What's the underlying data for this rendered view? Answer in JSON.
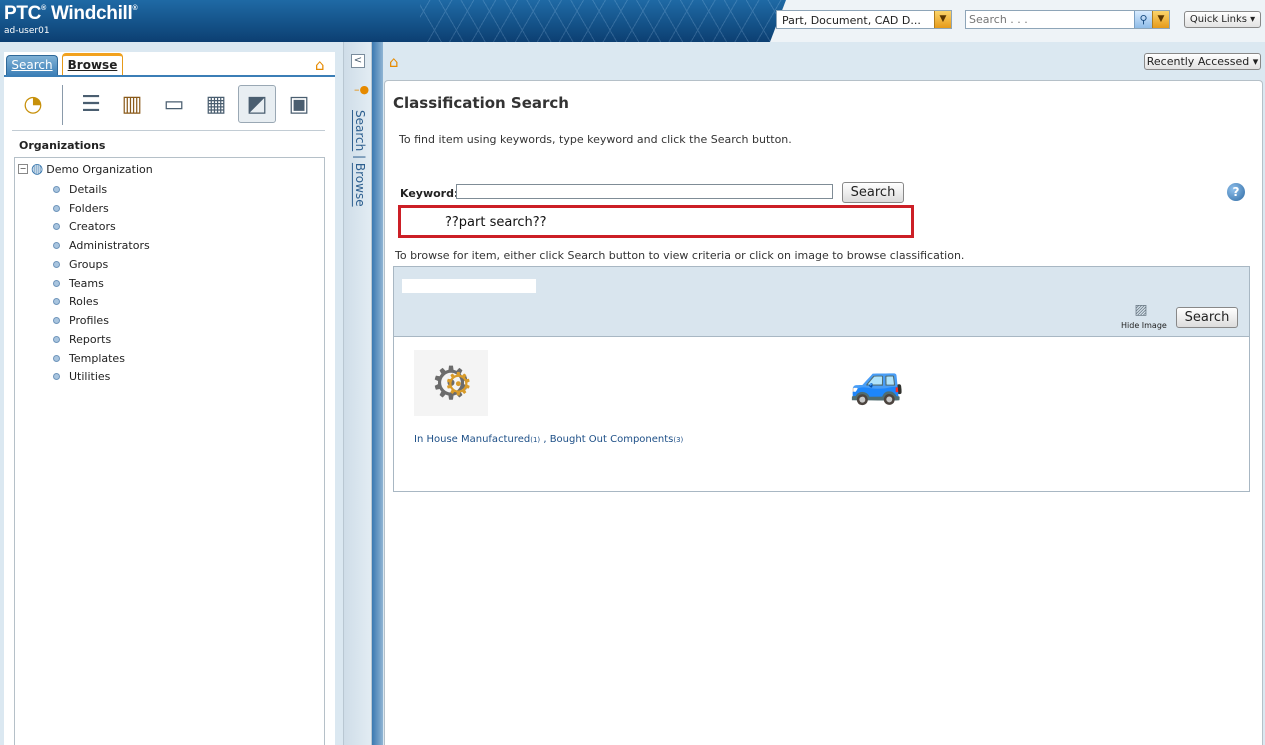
{
  "header": {
    "brand": "PTC",
    "brand_reg": "®",
    "brand_product": " Windchill",
    "brand_tm": "®",
    "user": "ad-user01",
    "type_select": "Part, Document, CAD D...",
    "search_placeholder": "Search . . .",
    "quick_links": "Quick Links ▾"
  },
  "left": {
    "tabs": [
      "Search",
      "Browse"
    ],
    "section_title": "Organizations",
    "org_root": "Demo Organization",
    "items": [
      "Details",
      "Folders",
      "Creators",
      "Administrators",
      "Groups",
      "Teams",
      "Roles",
      "Profiles",
      "Reports",
      "Templates",
      "Utilities"
    ]
  },
  "splitter": {
    "search_label": "Search",
    "divider": " | ",
    "browse_label": "Browse"
  },
  "main": {
    "recently_accessed": "Recently Accessed ▾",
    "title": "Classification Search",
    "instruction_keyword": "To find item using keywords, type keyword and click the Search button.",
    "keyword_label": "Keyword:",
    "keyword_value": "",
    "search_button": "Search",
    "annotation": "??part search??",
    "instruction_browse": "To browse for item, either click Search button to view criteria or click on image to browse classification.",
    "hide_image": "Hide Image",
    "result_link_1": "In House Manufactured",
    "result_count_1": "(1)",
    "result_sep": " , ",
    "result_link_2": "Bought Out Components",
    "result_count_2": "(3)"
  },
  "icons": {
    "home": "home-icon",
    "help": "help-icon",
    "tools": [
      "recent-clock-icon",
      "lists-icon",
      "library-icon",
      "clipboard-icon",
      "tables-icon",
      "classification-icon",
      "product-icon"
    ]
  },
  "colors": {
    "header_blue": "#0c3f72",
    "accent_orange": "#f2a21e",
    "annotation_red": "#cc1f26",
    "link_blue": "#1d4f87"
  }
}
